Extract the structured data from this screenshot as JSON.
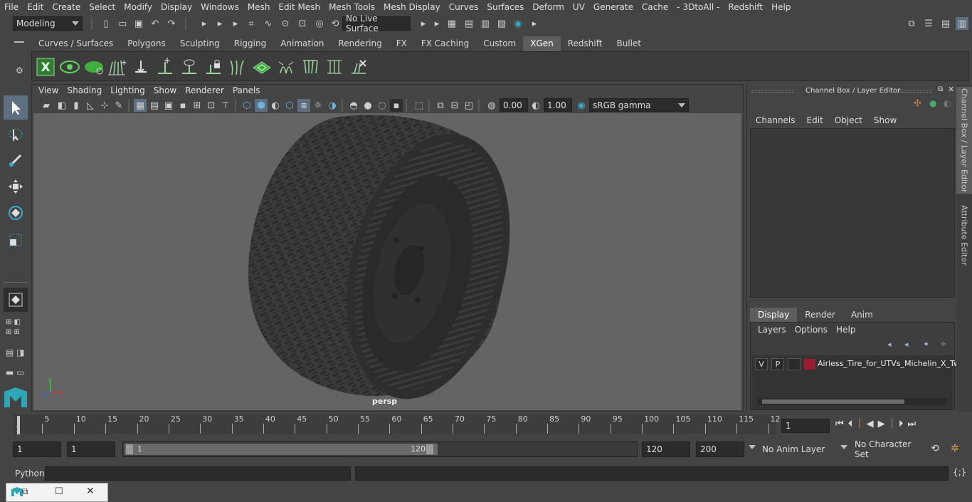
{
  "menubar": {
    "items": [
      "File",
      "Edit",
      "Create",
      "Select",
      "Modify",
      "Display",
      "Windows",
      "Mesh",
      "Edit Mesh",
      "Mesh Tools",
      "Mesh Display",
      "Curves",
      "Surfaces",
      "Deform",
      "UV",
      "Generate",
      "Cache",
      "- 3DtoAll -",
      "Redshift",
      "Help"
    ]
  },
  "status": {
    "mode": "Modeling",
    "live_surface": "No Live Surface"
  },
  "shelf": {
    "tabs": [
      "Curves / Surfaces",
      "Polygons",
      "Sculpting",
      "Rigging",
      "Animation",
      "Rendering",
      "FX",
      "FX Caching",
      "Custom",
      "XGen",
      "Redshift",
      "Bullet"
    ],
    "active_tab": "XGen"
  },
  "panel": {
    "menus": [
      "View",
      "Shading",
      "Lighting",
      "Show",
      "Renderer",
      "Panels"
    ],
    "exposure": "0.00",
    "gamma": "1.00",
    "color_space": "sRGB gamma",
    "camera_label": "persp"
  },
  "channel_box": {
    "title": "Channel Box / Layer Editor",
    "menus": [
      "Channels",
      "Edit",
      "Object",
      "Show"
    ],
    "layer_tabs": [
      "Display",
      "Render",
      "Anim"
    ],
    "active_layer_tab": "Display",
    "layer_menus": [
      "Layers",
      "Options",
      "Help"
    ],
    "layer": {
      "visible": "V",
      "playback": "P",
      "color": "#9b1b30",
      "name": "Airless_Tire_for_UTVs_Michelin_X_Tw"
    }
  },
  "side_tabs": {
    "channel_box": "Channel Box / Layer Editor",
    "attribute_editor": "Attribute Editor"
  },
  "timeline": {
    "ticks": [
      "5",
      "10",
      "15",
      "20",
      "25",
      "30",
      "35",
      "40",
      "45",
      "50",
      "55",
      "60",
      "65",
      "70",
      "75",
      "80",
      "85",
      "90",
      "95",
      "100",
      "105",
      "110",
      "115",
      "12"
    ],
    "start_marker": "1",
    "current_frame": "1"
  },
  "range": {
    "start": "1",
    "playback_start": "1",
    "slider_start": "1",
    "slider_end": "120",
    "playback_end": "120",
    "end": "200",
    "anim_layer": "No Anim Layer",
    "character_set": "No Character Set"
  },
  "command": {
    "language": "Python"
  },
  "colors": {
    "accent": "#5d5d5d",
    "shelf_green": "#3fae3f",
    "viewport_bg": "#646464"
  }
}
